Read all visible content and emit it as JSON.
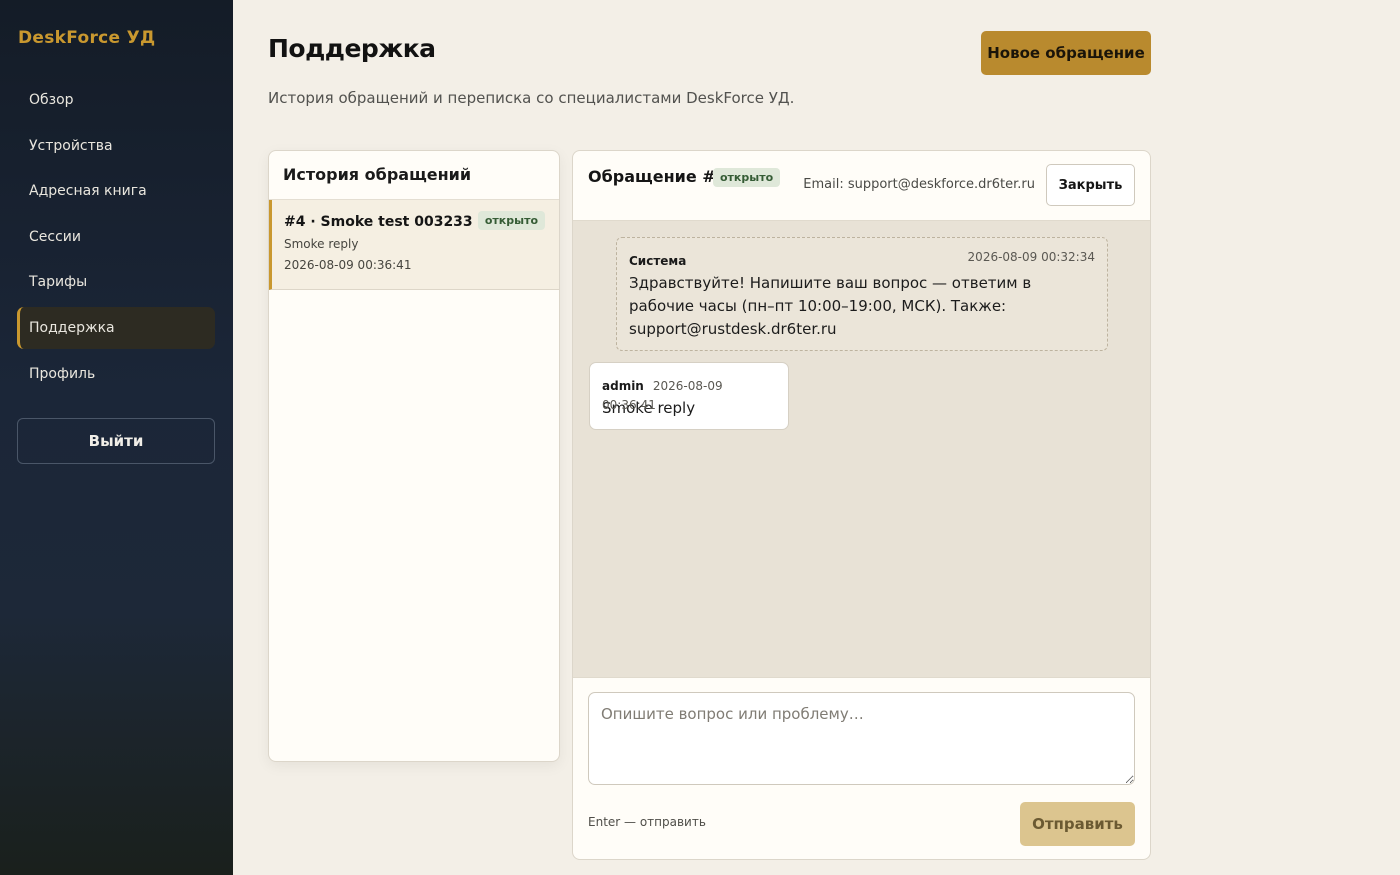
{
  "sidebar": {
    "logo": "DeskForce УД",
    "items": [
      {
        "label": "Обзор"
      },
      {
        "label": "Устройства"
      },
      {
        "label": "Адресная книга"
      },
      {
        "label": "Сессии"
      },
      {
        "label": "Тарифы"
      },
      {
        "label": "Поддержка",
        "active": true
      },
      {
        "label": "Профиль"
      }
    ],
    "logout_label": "Выйти"
  },
  "header": {
    "title": "Поддержка",
    "subtitle": "История обращений и переписка со специалистами DeskForce УД.",
    "new_ticket_label": "Новое обращение"
  },
  "history": {
    "title": "История обращений",
    "tickets": [
      {
        "title": "#4 · Smoke test 003233",
        "status": "открыто",
        "preview": "Smoke reply",
        "date": "2026-08-09 00:36:41"
      }
    ]
  },
  "chat": {
    "title": "Обращение #4",
    "status": "открыто",
    "email": "Email: support@deskforce.dr6ter.ru",
    "close_label": "Закрыть",
    "messages": [
      {
        "author": "Система",
        "time": "2026-08-09 00:32:34",
        "text": "Здравствуйте! Напишите ваш вопрос — ответим в рабочие часы (пн–пт 10:00–19:00, МСК). Также: support@rustdesk.dr6ter.ru"
      },
      {
        "author": "admin",
        "time": "2026-08-09 00:36:41",
        "text": "Smoke reply"
      }
    ],
    "composer": {
      "placeholder": "Опишите вопрос или проблему…",
      "hint": "Enter — отправить",
      "send_label": "Отправить"
    }
  },
  "colors": {
    "accent": "#c9982f",
    "button_primary": "#b98a2e",
    "button_disabled": "#dcc58f",
    "badge_bg": "#dfe8d9",
    "badge_text": "#355c35",
    "sidebar_bg": "#1b2638",
    "page_bg": "#f3efe7"
  }
}
